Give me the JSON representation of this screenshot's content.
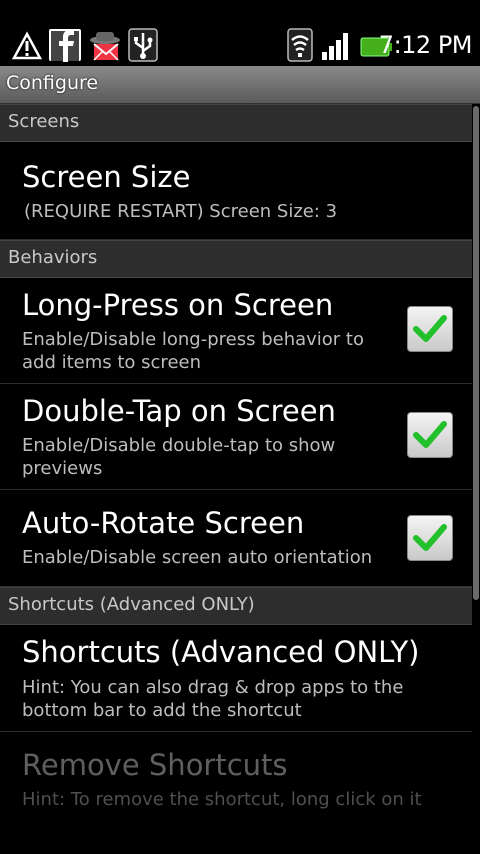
{
  "status_bar": {
    "time": "7:12 PM",
    "left_icons": [
      "warning-icon",
      "facebook-icon",
      "mail-spy-icon",
      "usb-icon"
    ],
    "right_icons": [
      "wifi-icon",
      "signal-icon",
      "battery-icon"
    ]
  },
  "title": "Configure",
  "sections": {
    "screens": "Screens",
    "behaviors": "Behaviors",
    "shortcuts": "Shortcuts (Advanced ONLY)"
  },
  "items": {
    "screen_size": {
      "title": "Screen Size",
      "summary": "(REQUIRE RESTART) Screen Size: 3"
    },
    "long_press": {
      "title": "Long-Press on Screen",
      "summary": "Enable/Disable long-press behavior to add items to screen",
      "checked": true
    },
    "double_tap": {
      "title": "Double-Tap on Screen",
      "summary": "Enable/Disable double-tap to show previews",
      "checked": true
    },
    "auto_rotate": {
      "title": "Auto-Rotate Screen",
      "summary": "Enable/Disable screen auto orientation",
      "checked": true
    },
    "shortcuts": {
      "title": "Shortcuts (Advanced ONLY)",
      "summary": "Hint: You can also drag & drop apps to the bottom bar to add the shortcut"
    },
    "remove_shortcuts": {
      "title": "Remove Shortcuts",
      "summary": "Hint: To remove the shortcut, long click on it",
      "enabled": false
    }
  },
  "colors": {
    "check_green": "#22c02a",
    "section_bg": "#2d2d2d"
  }
}
